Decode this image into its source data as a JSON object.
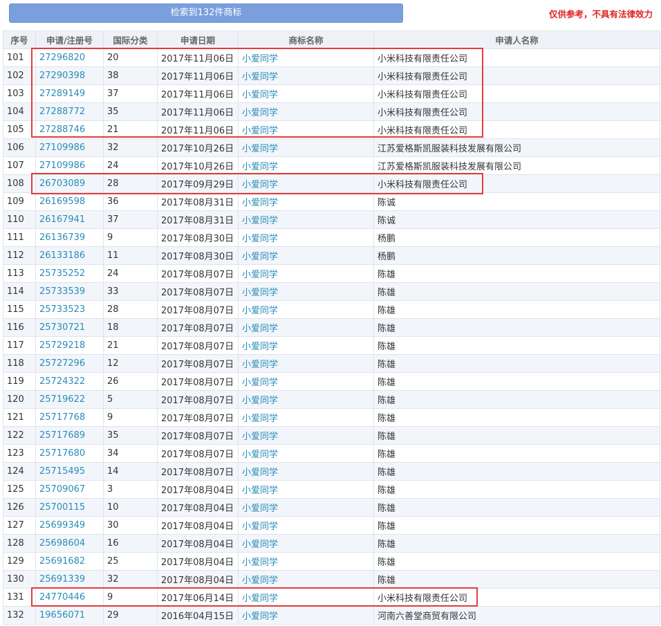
{
  "toolbar": {
    "result_label": "检索到132件商标",
    "disclaimer": "仅供参考，不具有法律效力"
  },
  "table": {
    "headers": [
      "序号",
      "申请/注册号",
      "国际分类",
      "申请日期",
      "商标名称",
      "申请人名称"
    ],
    "rows": [
      [
        "101",
        "27296820",
        "20",
        "2017年11月06日",
        "小爱同学",
        "小米科技有限责任公司"
      ],
      [
        "102",
        "27290398",
        "38",
        "2017年11月06日",
        "小爱同学",
        "小米科技有限责任公司"
      ],
      [
        "103",
        "27289149",
        "37",
        "2017年11月06日",
        "小爱同学",
        "小米科技有限责任公司"
      ],
      [
        "104",
        "27288772",
        "35",
        "2017年11月06日",
        "小爱同学",
        "小米科技有限责任公司"
      ],
      [
        "105",
        "27288746",
        "21",
        "2017年11月06日",
        "小爱同学",
        "小米科技有限责任公司"
      ],
      [
        "106",
        "27109986",
        "32",
        "2017年10月26日",
        "小爱同学",
        "江苏爱格斯凯服装科技发展有限公司"
      ],
      [
        "107",
        "27109986",
        "24",
        "2017年10月26日",
        "小爱同学",
        "江苏爱格斯凯服装科技发展有限公司"
      ],
      [
        "108",
        "26703089",
        "28",
        "2017年09月29日",
        "小爱同学",
        "小米科技有限责任公司"
      ],
      [
        "109",
        "26169598",
        "36",
        "2017年08月31日",
        "小爱同学",
        "陈诚"
      ],
      [
        "110",
        "26167941",
        "37",
        "2017年08月31日",
        "小爱同学",
        "陈诚"
      ],
      [
        "111",
        "26136739",
        "9",
        "2017年08月30日",
        "小爱同学",
        "杨鹏"
      ],
      [
        "112",
        "26133186",
        "11",
        "2017年08月30日",
        "小爱同学",
        "杨鹏"
      ],
      [
        "113",
        "25735252",
        "24",
        "2017年08月07日",
        "小爱同学",
        "陈雄"
      ],
      [
        "114",
        "25733539",
        "33",
        "2017年08月07日",
        "小爱同学",
        "陈雄"
      ],
      [
        "115",
        "25733523",
        "28",
        "2017年08月07日",
        "小爱同学",
        "陈雄"
      ],
      [
        "116",
        "25730721",
        "18",
        "2017年08月07日",
        "小爱同学",
        "陈雄"
      ],
      [
        "117",
        "25729218",
        "21",
        "2017年08月07日",
        "小爱同学",
        "陈雄"
      ],
      [
        "118",
        "25727296",
        "12",
        "2017年08月07日",
        "小爱同学",
        "陈雄"
      ],
      [
        "119",
        "25724322",
        "26",
        "2017年08月07日",
        "小爱同学",
        "陈雄"
      ],
      [
        "120",
        "25719622",
        "5",
        "2017年08月07日",
        "小爱同学",
        "陈雄"
      ],
      [
        "121",
        "25717768",
        "9",
        "2017年08月07日",
        "小爱同学",
        "陈雄"
      ],
      [
        "122",
        "25717689",
        "35",
        "2017年08月07日",
        "小爱同学",
        "陈雄"
      ],
      [
        "123",
        "25717680",
        "34",
        "2017年08月07日",
        "小爱同学",
        "陈雄"
      ],
      [
        "124",
        "25715495",
        "14",
        "2017年08月07日",
        "小爱同学",
        "陈雄"
      ],
      [
        "125",
        "25709067",
        "3",
        "2017年08月04日",
        "小爱同学",
        "陈雄"
      ],
      [
        "126",
        "25700115",
        "10",
        "2017年08月04日",
        "小爱同学",
        "陈雄"
      ],
      [
        "127",
        "25699349",
        "30",
        "2017年08月04日",
        "小爱同学",
        "陈雄"
      ],
      [
        "128",
        "25698604",
        "16",
        "2017年08月04日",
        "小爱同学",
        "陈雄"
      ],
      [
        "129",
        "25691682",
        "25",
        "2017年08月04日",
        "小爱同学",
        "陈雄"
      ],
      [
        "130",
        "25691339",
        "32",
        "2017年08月04日",
        "小爱同学",
        "陈雄"
      ],
      [
        "131",
        "24770446",
        "9",
        "2017年06月14日",
        "小爱同学",
        "小米科技有限责任公司"
      ],
      [
        "132",
        "19656071",
        "29",
        "2016年04月15日",
        "小爱同学",
        "河南六善堂商贸有限公司"
      ]
    ]
  },
  "colors": {
    "button": "#7a9fdc",
    "disclaimer": "#e02020",
    "link": "#2a8bb7",
    "highlight": "#e33b3b"
  }
}
